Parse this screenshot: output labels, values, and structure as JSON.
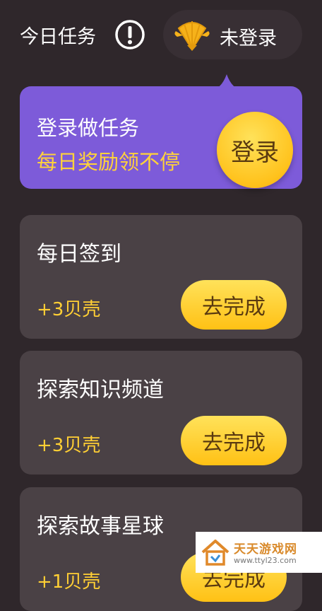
{
  "header": {
    "title": "今日任务",
    "info_icon": "exclamation-circle-icon",
    "login_status": "未登录",
    "avatar_icon": "shell-icon"
  },
  "banner": {
    "line1": "登录做任务",
    "line2": "每日奖励领不停",
    "button_label": "登录",
    "background": "#7d5bd9",
    "accent": "#ffd23a"
  },
  "tasks": [
    {
      "name": "每日签到",
      "reward": "+3贝壳",
      "button_label": "去完成"
    },
    {
      "name": "探索知识频道",
      "reward": "+3贝壳",
      "button_label": "去完成"
    },
    {
      "name": "探索故事星球",
      "reward": "+1贝壳",
      "button_label": "去完成"
    }
  ],
  "watermark": {
    "name": "天天游戏网",
    "url": "www.ttyl23.com"
  },
  "colors": {
    "page_bg": "#2f272b",
    "card_bg": "#4a4145",
    "button_yellow": "#ffc21c",
    "reward_text": "#ffcf34"
  }
}
